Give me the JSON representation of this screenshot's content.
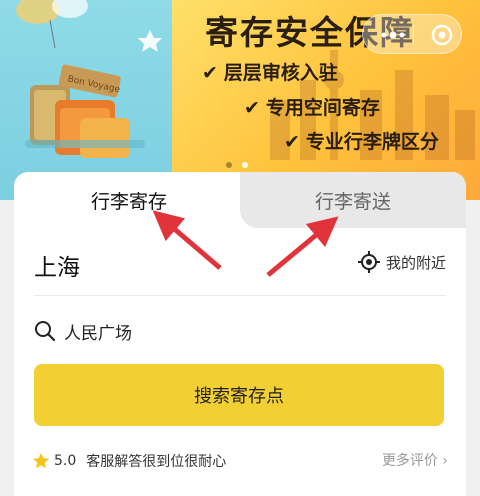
{
  "banner": {
    "title": "寄存安全保障",
    "features": [
      "层层审核入驻",
      "专用空间寄存",
      "专业行李牌区分"
    ],
    "check_glyph": "✔"
  },
  "tabs": {
    "store": "行李寄存",
    "send": "行李寄送"
  },
  "location": {
    "city": "上海",
    "nearby_label": "我的附近"
  },
  "search": {
    "value": "人民广场"
  },
  "search_button": "搜索寄存点",
  "review": {
    "rating": "5.0",
    "text": "客服解答很到位很耐心",
    "more": "更多评价 ›"
  },
  "colors": {
    "accent": "#f2cf32",
    "arrow": "#e0343a"
  }
}
